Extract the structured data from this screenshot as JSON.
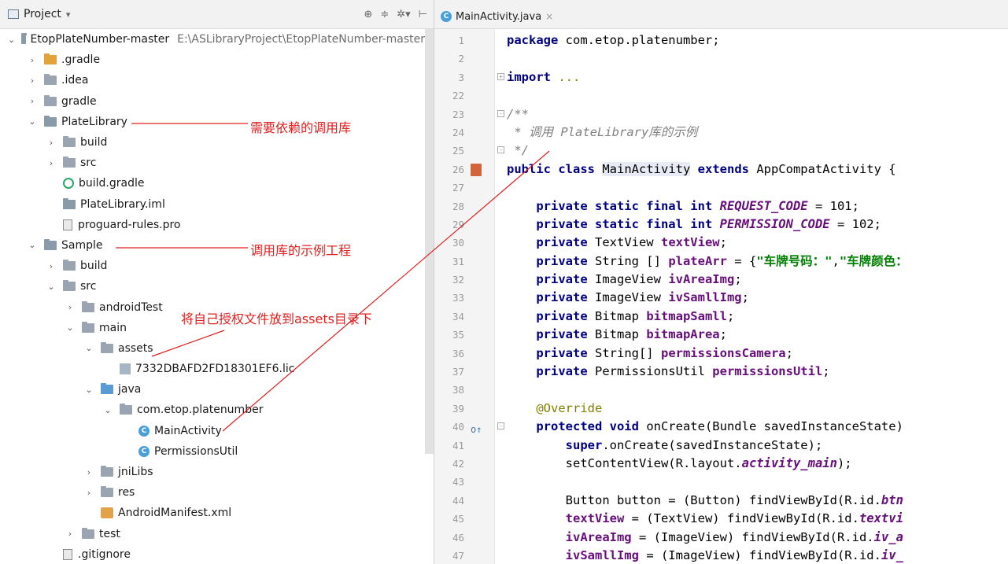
{
  "left_panel": {
    "title": "Project",
    "title_caret": "▾",
    "tools": [
      "⊕",
      "≑",
      "✲▾",
      "⊢"
    ],
    "tree": [
      {
        "indent": 0,
        "arrow": "⌄",
        "icon": "module-folder",
        "label": "EtopPlateNumber-master",
        "path": "E:\\ASLibraryProject\\EtopPlateNumber-master"
      },
      {
        "indent": 1,
        "arrow": "›",
        "icon": "folder-orange",
        "label": ".gradle"
      },
      {
        "indent": 1,
        "arrow": "›",
        "icon": "folder",
        "label": ".idea"
      },
      {
        "indent": 1,
        "arrow": "›",
        "icon": "folder",
        "label": "gradle"
      },
      {
        "indent": 1,
        "arrow": "⌄",
        "icon": "module-folder",
        "label": "PlateLibrary"
      },
      {
        "indent": 2,
        "arrow": "›",
        "icon": "folder",
        "label": "build"
      },
      {
        "indent": 2,
        "arrow": "›",
        "icon": "folder",
        "label": "src"
      },
      {
        "indent": 2,
        "arrow": "",
        "icon": "gradle-file",
        "label": "build.gradle"
      },
      {
        "indent": 2,
        "arrow": "",
        "icon": "iml-file",
        "label": "PlateLibrary.iml"
      },
      {
        "indent": 2,
        "arrow": "",
        "icon": "text-file",
        "label": "proguard-rules.pro"
      },
      {
        "indent": 1,
        "arrow": "⌄",
        "icon": "module-folder",
        "label": "Sample"
      },
      {
        "indent": 2,
        "arrow": "›",
        "icon": "folder",
        "label": "build"
      },
      {
        "indent": 2,
        "arrow": "⌄",
        "icon": "folder",
        "label": "src"
      },
      {
        "indent": 3,
        "arrow": "›",
        "icon": "folder",
        "label": "androidTest"
      },
      {
        "indent": 3,
        "arrow": "⌄",
        "icon": "folder",
        "label": "main"
      },
      {
        "indent": 4,
        "arrow": "⌄",
        "icon": "resource-folder",
        "label": "assets"
      },
      {
        "indent": 5,
        "arrow": "",
        "icon": "license-file",
        "label": "7332DBAFD2FD18301EF6.lic"
      },
      {
        "indent": 4,
        "arrow": "⌄",
        "icon": "folder-blue",
        "label": "java"
      },
      {
        "indent": 5,
        "arrow": "⌄",
        "icon": "package-folder",
        "label": "com.etop.platenumber"
      },
      {
        "indent": 6,
        "arrow": "",
        "icon": "class",
        "label": "MainActivity"
      },
      {
        "indent": 6,
        "arrow": "",
        "icon": "class",
        "label": "PermissionsUtil"
      },
      {
        "indent": 4,
        "arrow": "›",
        "icon": "folder",
        "label": "jniLibs"
      },
      {
        "indent": 4,
        "arrow": "›",
        "icon": "resource-folder",
        "label": "res"
      },
      {
        "indent": 4,
        "arrow": "",
        "icon": "xml-file",
        "label": "AndroidManifest.xml"
      },
      {
        "indent": 3,
        "arrow": "›",
        "icon": "folder",
        "label": "test"
      },
      {
        "indent": 2,
        "arrow": "",
        "icon": "text-file",
        "label": ".gitignore"
      }
    ]
  },
  "annotations": {
    "platelibrary": "需要依赖的调用库",
    "sample": "调用库的示例工程",
    "assets": "将自己授权文件放到assets目录下"
  },
  "editor": {
    "tab_label": "MainActivity.java",
    "tab_close": "×",
    "tab_icon_letter": "C",
    "class_icon_letter": "C",
    "lines": [
      {
        "n": "1",
        "html": "<span class=\"k\">package</span> com.etop.platenumber;"
      },
      {
        "n": "2",
        "html": ""
      },
      {
        "n": "3",
        "html": "<span class=\"k\">import</span> <span class=\"ann\">...</span>",
        "fold": "+"
      },
      {
        "n": "22",
        "html": ""
      },
      {
        "n": "23",
        "html": "<span class=\"cm\">/**</span>",
        "fold": "-"
      },
      {
        "n": "24",
        "html": "<span class=\"cm\"> * 调用 PlateLibrary库的示例</span>"
      },
      {
        "n": "25",
        "html": "<span class=\"cm\"> */</span>",
        "fold": "-"
      },
      {
        "n": "26",
        "html": "<span class=\"k\">public class</span> <span class=\"hl\">MainActivity</span> <span class=\"k\">extends</span> AppCompatActivity {",
        "marker": "layout"
      },
      {
        "n": "27",
        "html": ""
      },
      {
        "n": "28",
        "html": "    <span class=\"k\">private static final int</span> <span class=\"sfld\">REQUEST_CODE</span> = 101;"
      },
      {
        "n": "29",
        "html": "    <span class=\"k\">private static final int</span> <span class=\"sfld\">PERMISSION_CODE</span> = 102;"
      },
      {
        "n": "30",
        "html": "    <span class=\"k\">private</span> TextView <span class=\"fld\">textView</span>;"
      },
      {
        "n": "31",
        "html": "    <span class=\"k\">private</span> String [] <span class=\"fld\">plateArr</span> = {<span class=\"str\">\"车牌号码：\"</span>,<span class=\"str\">\"车牌颜色：</span>"
      },
      {
        "n": "32",
        "html": "    <span class=\"k\">private</span> ImageView <span class=\"fld\">ivAreaImg</span>;"
      },
      {
        "n": "33",
        "html": "    <span class=\"k\">private</span> ImageView <span class=\"fld\">ivSamllImg</span>;"
      },
      {
        "n": "34",
        "html": "    <span class=\"k\">private</span> Bitmap <span class=\"fld\">bitmapSamll</span>;"
      },
      {
        "n": "35",
        "html": "    <span class=\"k\">private</span> Bitmap <span class=\"fld\">bitmapArea</span>;"
      },
      {
        "n": "36",
        "html": "    <span class=\"k\">private</span> String[] <span class=\"fld\">permissionsCamera</span>;"
      },
      {
        "n": "37",
        "html": "    <span class=\"k\">private</span> PermissionsUtil <span class=\"fld\">permissionsUtil</span>;"
      },
      {
        "n": "38",
        "html": ""
      },
      {
        "n": "39",
        "html": "    <span class=\"ann\">@Override</span>"
      },
      {
        "n": "40",
        "html": "    <span class=\"k\">protected void</span> onCreate(Bundle savedInstanceState)",
        "marker": "override",
        "fold": "-"
      },
      {
        "n": "41",
        "html": "        <span class=\"k\">super</span>.onCreate(savedInstanceState);"
      },
      {
        "n": "42",
        "html": "        setContentView(R.layout.<span class=\"sfld\">activity_main</span>);"
      },
      {
        "n": "43",
        "html": ""
      },
      {
        "n": "44",
        "html": "        Button button = (Button) findViewById(R.id.<span class=\"sfld\">btn</span>"
      },
      {
        "n": "45",
        "html": "        <span class=\"fld\">textView</span> = (TextView) findViewById(R.id.<span class=\"sfld\">textvi</span>"
      },
      {
        "n": "46",
        "html": "        <span class=\"fld\">ivAreaImg</span> = (ImageView) findViewById(R.id.<span class=\"sfld\">iv_a</span>"
      },
      {
        "n": "47",
        "html": "        <span class=\"fld\">ivSamllImg</span> = (ImageView) findViewById(R.id.<span class=\"sfld\">iv_</span>"
      }
    ]
  },
  "colors": {
    "annotation_red": "#e02020",
    "keyword": "#000080",
    "field": "#660e7a",
    "string": "#008000",
    "comment": "#808080"
  }
}
